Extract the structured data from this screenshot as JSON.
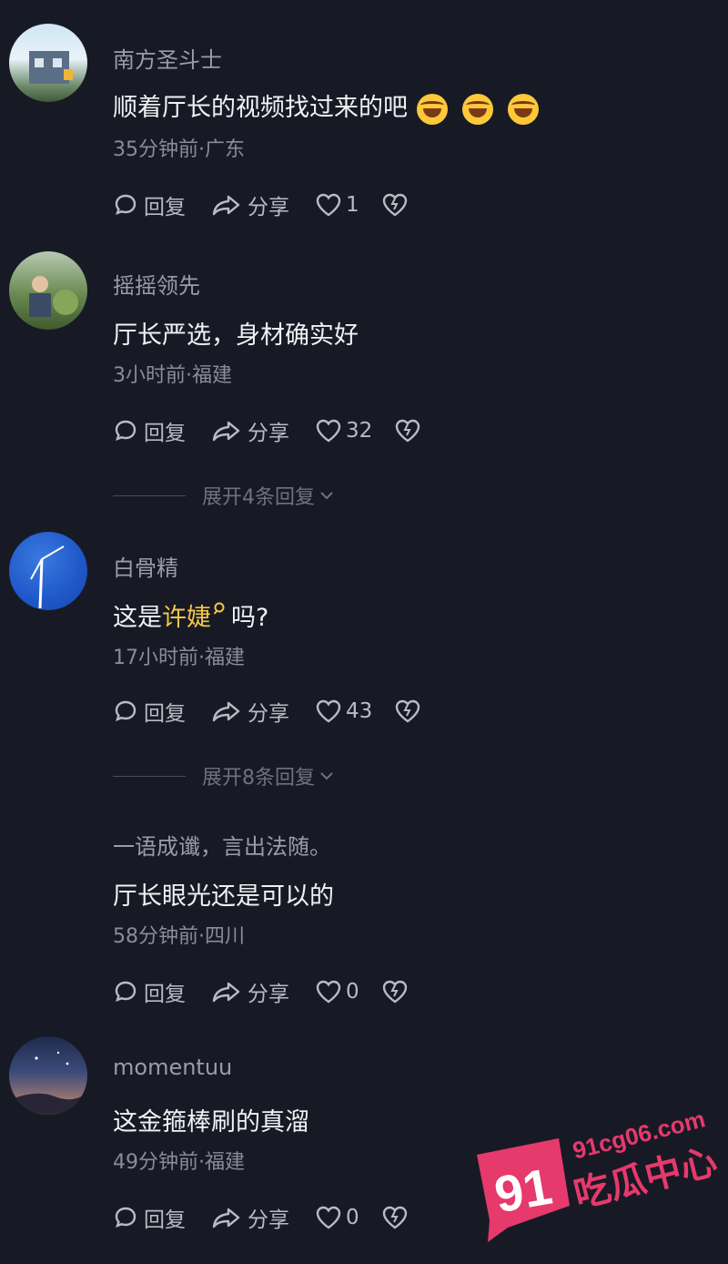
{
  "comments": [
    {
      "username": "南方圣斗士",
      "text": "顺着厅长的视频找过来的吧",
      "emojis": [
        "rolling-laughing-emoji",
        "rolling-laughing-emoji",
        "rolling-laughing-emoji"
      ],
      "meta": "35分钟前·广东",
      "reply_label": "回复",
      "share_label": "分享",
      "likes": "1"
    },
    {
      "username": "摇摇领先",
      "text": "厅长严选，身材确实好",
      "meta": "3小时前·福建",
      "reply_label": "回复",
      "share_label": "分享",
      "likes": "32",
      "expand_label": "展开4条回复"
    },
    {
      "username": "白骨精",
      "text_prefix": "这是",
      "text_highlight": "许婕",
      "text_suffix": "吗?",
      "meta": "17小时前·福建",
      "reply_label": "回复",
      "share_label": "分享",
      "likes": "43",
      "expand_label": "展开8条回复"
    },
    {
      "username": "一语成谶，言出法随。",
      "text": "厅长眼光还是可以的",
      "meta": "58分钟前·四川",
      "reply_label": "回复",
      "share_label": "分享",
      "likes": "0"
    },
    {
      "username": "momentuu",
      "text": "这金箍棒刷的真溜",
      "meta": "49分钟前·福建",
      "reply_label": "回复",
      "share_label": "分享",
      "likes": "0"
    }
  ],
  "watermark": {
    "site": "91cg06.com",
    "number": "91",
    "brand": "吃瓜中心"
  },
  "colors": {
    "background": "#171a25",
    "highlight": "#f3c646",
    "watermark": "#e6396c"
  }
}
